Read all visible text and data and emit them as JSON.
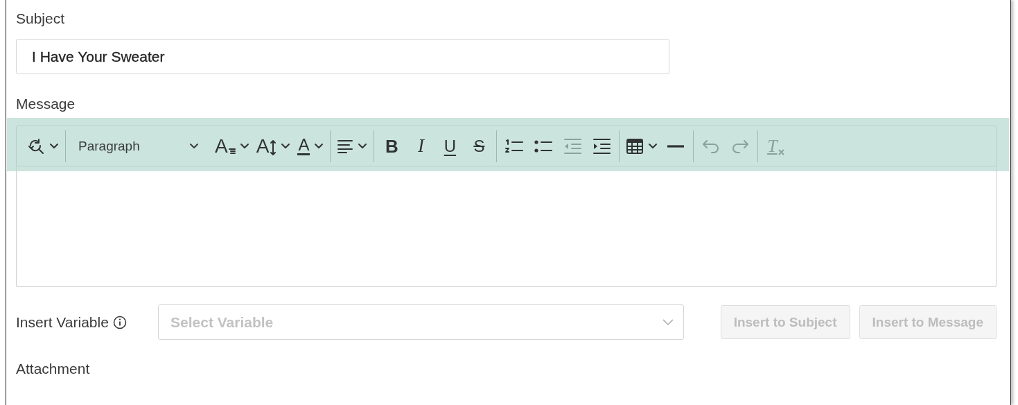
{
  "subject": {
    "label": "Subject",
    "value": "I Have Your Sweater"
  },
  "message": {
    "label": "Message",
    "toolbar": [
      {
        "kind": "button",
        "dropdown": true,
        "disabled": false
      },
      {
        "kind": "separator"
      },
      {
        "kind": "select",
        "value": "Paragraph"
      },
      {
        "kind": "button",
        "glyph": "A",
        "dropdown": true,
        "disabled": false
      },
      {
        "kind": "button",
        "glyph": "A",
        "dropdown": true,
        "disabled": false
      },
      {
        "kind": "button",
        "glyph": "A",
        "dropdown": true,
        "disabled": false
      },
      {
        "kind": "separator"
      },
      {
        "kind": "button",
        "dropdown": true,
        "disabled": false
      },
      {
        "kind": "separator"
      },
      {
        "kind": "button",
        "glyph": "B",
        "dropdown": false,
        "disabled": false
      },
      {
        "kind": "button",
        "glyph": "I",
        "dropdown": false,
        "disabled": false
      },
      {
        "kind": "button",
        "glyph": "U",
        "dropdown": false,
        "disabled": false
      },
      {
        "kind": "button",
        "glyph": "S",
        "dropdown": false,
        "disabled": false
      },
      {
        "kind": "separator"
      },
      {
        "kind": "button",
        "dropdown": false,
        "disabled": false
      },
      {
        "kind": "button",
        "dropdown": false,
        "disabled": false
      },
      {
        "kind": "button",
        "dropdown": false,
        "disabled": true
      },
      {
        "kind": "button",
        "dropdown": false,
        "disabled": false
      },
      {
        "kind": "separator"
      },
      {
        "kind": "button",
        "dropdown": true,
        "disabled": false
      },
      {
        "kind": "button",
        "dropdown": false,
        "disabled": false
      },
      {
        "kind": "separator"
      },
      {
        "kind": "button",
        "dropdown": false,
        "disabled": true
      },
      {
        "kind": "button",
        "dropdown": false,
        "disabled": true
      },
      {
        "kind": "separator"
      },
      {
        "kind": "button",
        "glyph": "T",
        "dropdown": false,
        "disabled": true
      }
    ]
  },
  "insert_variable": {
    "label": "Insert Variable",
    "placeholder": "Select Variable",
    "buttons": [
      {
        "label": "Insert to Subject",
        "disabled": true
      },
      {
        "label": "Insert to Message",
        "disabled": true
      }
    ]
  },
  "attachment": {
    "label": "Attachment"
  }
}
